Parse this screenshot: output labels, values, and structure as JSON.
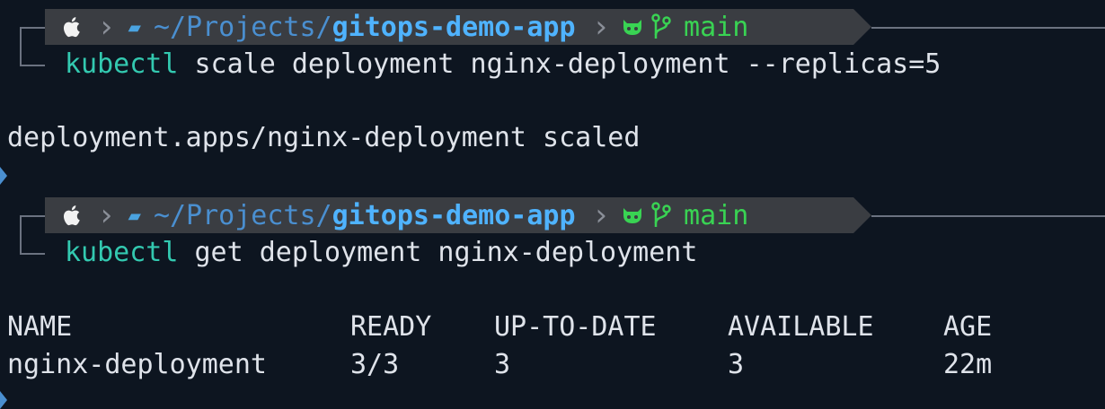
{
  "prompts": [
    {
      "path_prefix": "~/Projects/",
      "path_repo": "gitops-demo-app",
      "branch": "main",
      "command_name": "kubectl",
      "command_args": " scale deployment nginx-deployment --replicas=5"
    },
    {
      "path_prefix": "~/Projects/",
      "path_repo": "gitops-demo-app",
      "branch": "main",
      "command_name": "kubectl",
      "command_args": " get deployment nginx-deployment"
    }
  ],
  "outputs": {
    "scale_result": "deployment.apps/nginx-deployment scaled"
  },
  "table": {
    "headers": [
      "NAME",
      "READY",
      "UP-TO-DATE",
      "AVAILABLE",
      "AGE"
    ],
    "rows": [
      [
        "nginx-deployment",
        "3/3",
        "3",
        "3",
        "22m"
      ]
    ]
  },
  "icons": {
    "os": "apple-icon",
    "folder": "folder-icon",
    "vcs_host": "github-icon",
    "branch": "git-branch-icon"
  },
  "colors": {
    "background": "#0d1520",
    "prompt_bar": "#3a3d42",
    "path": "#4fb3ff",
    "branch": "#39d353",
    "command": "#33c9b0"
  }
}
